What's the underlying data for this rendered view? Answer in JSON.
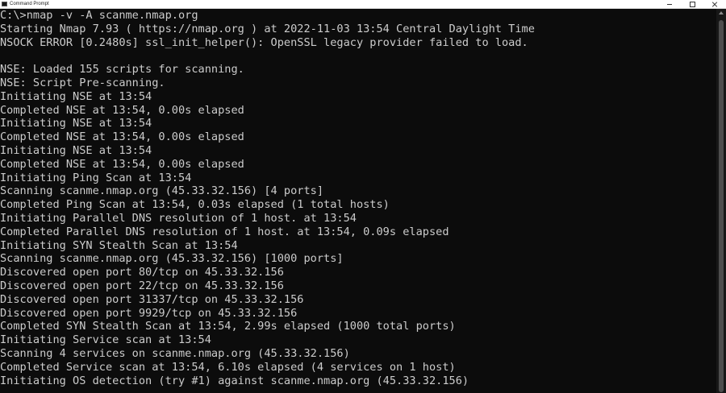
{
  "window": {
    "title": "Command Prompt"
  },
  "console": {
    "lines": [
      "C:\\>nmap -v -A scanme.nmap.org",
      "Starting Nmap 7.93 ( https://nmap.org ) at 2022-11-03 13:54 Central Daylight Time",
      "NSOCK ERROR [0.2480s] ssl_init_helper(): OpenSSL legacy provider failed to load.",
      "",
      "NSE: Loaded 155 scripts for scanning.",
      "NSE: Script Pre-scanning.",
      "Initiating NSE at 13:54",
      "Completed NSE at 13:54, 0.00s elapsed",
      "Initiating NSE at 13:54",
      "Completed NSE at 13:54, 0.00s elapsed",
      "Initiating NSE at 13:54",
      "Completed NSE at 13:54, 0.00s elapsed",
      "Initiating Ping Scan at 13:54",
      "Scanning scanme.nmap.org (45.33.32.156) [4 ports]",
      "Completed Ping Scan at 13:54, 0.03s elapsed (1 total hosts)",
      "Initiating Parallel DNS resolution of 1 host. at 13:54",
      "Completed Parallel DNS resolution of 1 host. at 13:54, 0.09s elapsed",
      "Initiating SYN Stealth Scan at 13:54",
      "Scanning scanme.nmap.org (45.33.32.156) [1000 ports]",
      "Discovered open port 80/tcp on 45.33.32.156",
      "Discovered open port 22/tcp on 45.33.32.156",
      "Discovered open port 31337/tcp on 45.33.32.156",
      "Discovered open port 9929/tcp on 45.33.32.156",
      "Completed SYN Stealth Scan at 13:54, 2.99s elapsed (1000 total ports)",
      "Initiating Service scan at 13:54",
      "Scanning 4 services on scanme.nmap.org (45.33.32.156)",
      "Completed Service scan at 13:54, 6.10s elapsed (4 services on 1 host)",
      "Initiating OS detection (try #1) against scanme.nmap.org (45.33.32.156)"
    ]
  },
  "colors": {
    "background": "#0c0c0c",
    "text": "#cccccc"
  },
  "icons": {
    "app": "cmd-icon",
    "minimize": "minimize-icon",
    "maximize": "maximize-icon",
    "close": "close-icon"
  }
}
